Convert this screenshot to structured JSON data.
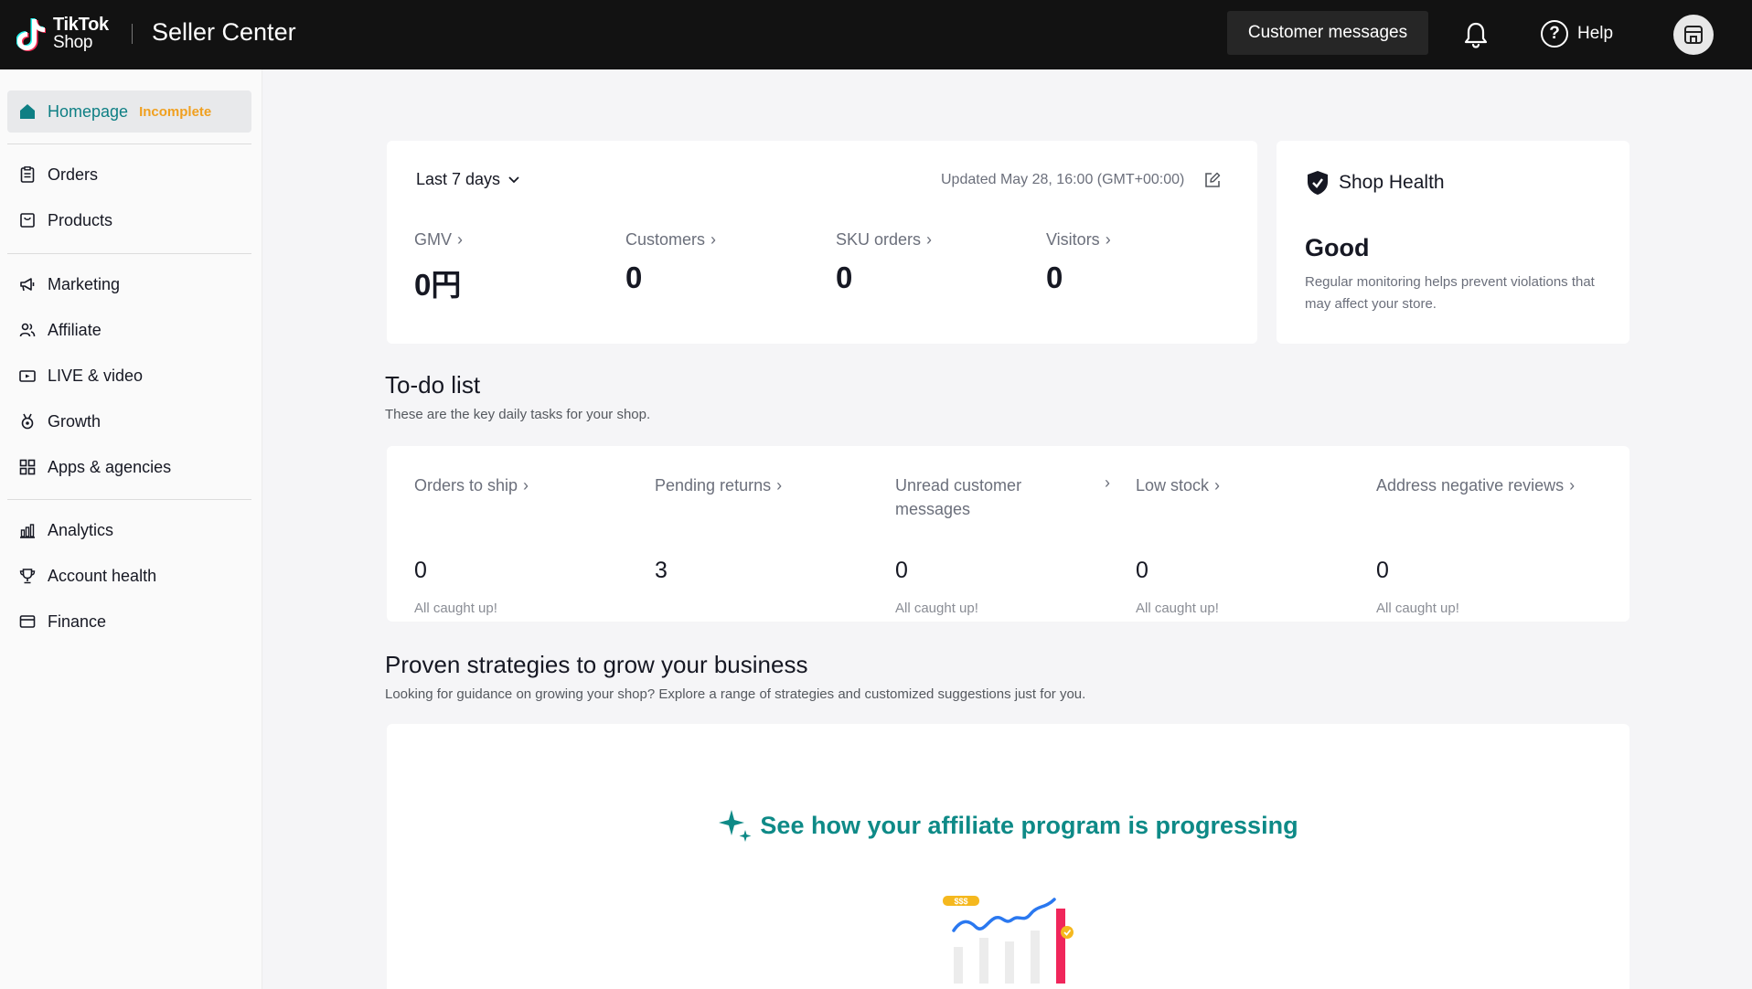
{
  "topbar": {
    "logo_line1": "TikTok",
    "logo_line2": "Shop",
    "brand": "Seller Center",
    "customer_messages": "Customer messages",
    "help": "Help"
  },
  "sidebar": {
    "homepage": {
      "label": "Homepage",
      "badge": "Incomplete"
    },
    "items": [
      {
        "label": "Orders",
        "icon": "clipboard-icon"
      },
      {
        "label": "Products",
        "icon": "box-icon"
      },
      {
        "label": "Marketing",
        "icon": "megaphone-icon"
      },
      {
        "label": "Affiliate",
        "icon": "people-icon"
      },
      {
        "label": "LIVE & video",
        "icon": "video-icon"
      },
      {
        "label": "Growth",
        "icon": "medal-icon"
      },
      {
        "label": "Apps & agencies",
        "icon": "grid-icon"
      },
      {
        "label": "Analytics",
        "icon": "bar-chart-icon"
      },
      {
        "label": "Account health",
        "icon": "trophy-icon"
      },
      {
        "label": "Finance",
        "icon": "wallet-icon"
      }
    ]
  },
  "stats": {
    "period": "Last 7 days",
    "updated": "Updated May 28, 16:00 (GMT+00:00)",
    "metrics": [
      {
        "label": "GMV",
        "value": "0円"
      },
      {
        "label": "Customers",
        "value": "0"
      },
      {
        "label": "SKU orders",
        "value": "0"
      },
      {
        "label": "Visitors",
        "value": "0"
      }
    ]
  },
  "health": {
    "title": "Shop Health",
    "status": "Good",
    "description": "Regular monitoring helps prevent violations that may affect your store."
  },
  "todo": {
    "title": "To-do list",
    "subtitle": "These are the key daily tasks for your shop.",
    "items": [
      {
        "label": "Orders to ship",
        "value": "0",
        "status": "All caught up!"
      },
      {
        "label": "Pending returns",
        "value": "3",
        "status": ""
      },
      {
        "label": "Unread customer messages",
        "value": "0",
        "status": "All caught up!"
      },
      {
        "label": "Low stock",
        "value": "0",
        "status": "All caught up!"
      },
      {
        "label": "Address negative reviews",
        "value": "0",
        "status": "All caught up!"
      }
    ]
  },
  "strategies": {
    "title": "Proven strategies to grow your business",
    "subtitle": "Looking for guidance on growing your shop? Explore a range of strategies and customized suggestions just for you.",
    "promo": "See how your affiliate program is progressing",
    "illustration_badge": "$$$"
  },
  "colors": {
    "topbar_bg": "#121212",
    "accent_teal": "#0e8a87",
    "incomplete_orange": "#f0a020"
  }
}
